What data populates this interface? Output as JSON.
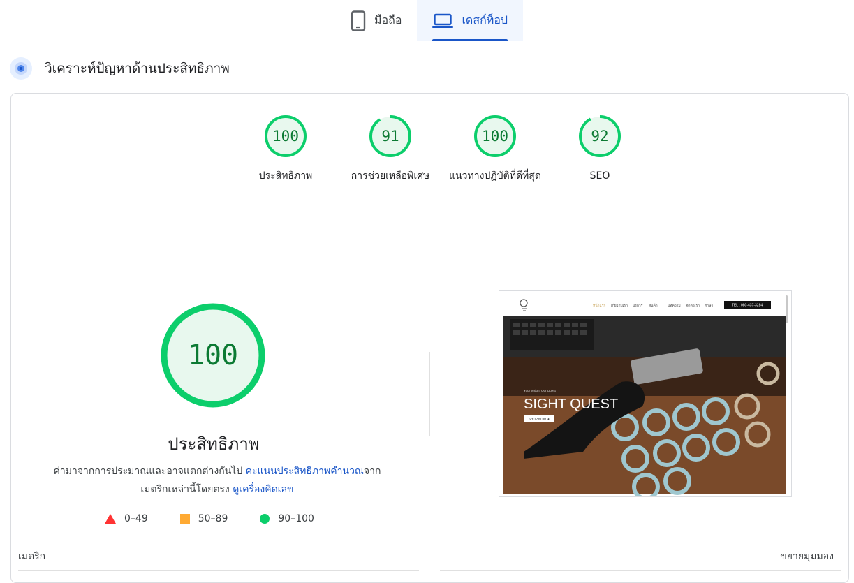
{
  "tabs": [
    {
      "label": "มือถือ",
      "icon": "smartphone-icon",
      "active": false
    },
    {
      "label": "เดสก์ท็อป",
      "icon": "laptop-icon",
      "active": true
    }
  ],
  "section": {
    "title": "วิเคราะห์ปัญหาด้านประสิทธิภาพ",
    "icon": "pulse-icon"
  },
  "gauges": [
    {
      "score": "100",
      "label": "ประสิทธิภาพ",
      "fraction": 1.0
    },
    {
      "score": "91",
      "label": "การช่วยเหลือพิเศษ",
      "fraction": 0.91
    },
    {
      "score": "100",
      "label": "แนวทางปฏิบัติที่ดีที่สุด",
      "fraction": 1.0
    },
    {
      "score": "92",
      "label": "SEO",
      "fraction": 0.92
    }
  ],
  "main": {
    "score": "100",
    "title": "ประสิทธิภาพ",
    "desc_prefix": "ค่ามาจากการประมาณและอาจแตกต่างกันไป ",
    "desc_link1": "คะแนนประสิทธิภาพคำนวณ",
    "desc_middle": "จากเมตริกเหล่านี้โดยตรง ",
    "desc_link2": "ดูเครื่องคิดเลข"
  },
  "legend": [
    {
      "range": "0–49",
      "shape": "triangle",
      "color": "#ff3333"
    },
    {
      "range": "50–89",
      "shape": "square",
      "color": "#ffaa33"
    },
    {
      "range": "90–100",
      "shape": "circle",
      "color": "#0cce6b"
    }
  ],
  "screenshot": {
    "nav_items": [
      "หน้าแรก",
      "เกี่ยวกับเรา",
      "บริการ",
      "สินค้า",
      "บทความ",
      "ติดต่อเรา",
      "ภาษา"
    ],
    "phone": "TEL : 080-437-3284",
    "tagline": "Your Vision, Our Quest",
    "headline": "SIGHT QUEST",
    "cta": "SHOP NOW  ➜"
  },
  "metrics": {
    "label": "เมตริก",
    "expand": "ขยายมุมมอง"
  },
  "colors": {
    "pass": "#0cce6b",
    "pass_text": "#0c7a33",
    "pass_bg": "#e8f8ee",
    "accent": "#1a56c8"
  }
}
